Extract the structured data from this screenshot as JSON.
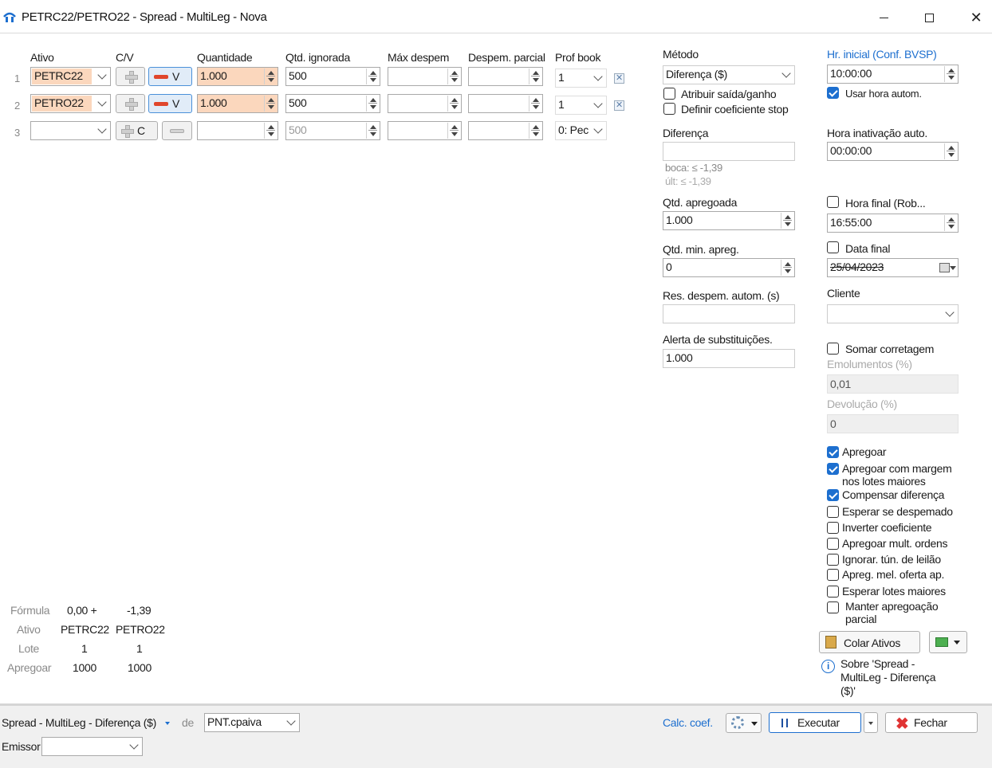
{
  "window": {
    "title": "PETRC22/PETRO22 - Spread - MultiLeg - Nova"
  },
  "grid": {
    "headers": {
      "ativo": "Ativo",
      "cv": "C/V",
      "quantidade": "Quantidade",
      "qtd_ignorada": "Qtd. ignorada",
      "max_despem": "Máx despem",
      "despem_parcial": "Despem. parcial",
      "prof_book": "Prof book"
    },
    "rows": [
      {
        "num": "1",
        "ativo": "PETRC22",
        "side_label": "V",
        "quantidade": "1.000",
        "qtd_ignorada": "500",
        "max_despem": "",
        "despem_parcial": "",
        "prof_book": "1"
      },
      {
        "num": "2",
        "ativo": "PETRO22",
        "side_label": "V",
        "quantidade": "1.000",
        "qtd_ignorada": "500",
        "max_despem": "",
        "despem_parcial": "",
        "prof_book": "1"
      },
      {
        "num": "3",
        "ativo": "",
        "side_label": "C",
        "quantidade": "",
        "qtd_ignorada": "500",
        "max_despem": "",
        "despem_parcial": "",
        "prof_book": "0: Pec"
      }
    ]
  },
  "formula": {
    "labels": {
      "formula": "Fórmula",
      "ativo": "Ativo",
      "lote": "Lote",
      "apregoar": "Apregoar"
    },
    "cols": [
      {
        "formula": "0,00 +",
        "ativo": "PETRC22",
        "lote": "1",
        "apregoar": "1000"
      },
      {
        "formula": "-1,39",
        "ativo": "PETRO22",
        "lote": "1",
        "apregoar": "1000"
      }
    ]
  },
  "mid": {
    "metodo_label": "Método",
    "metodo_value": "Diferença ($)",
    "atribuir_label": "Atribuir saída/ganho",
    "definir_label": "Definir coeficiente stop",
    "diferenca_label": "Diferença",
    "diferenca_value": "",
    "boca": "boca: ≤ -1,39",
    "ult": "últ: ≤ -1,39",
    "qtd_apregoada_label": "Qtd. apregoada",
    "qtd_apregoada_value": "1.000",
    "qtd_min_label": "Qtd. min. apreg.",
    "qtd_min_value": "0",
    "res_despem_label": "Res. despem. autom. (s)",
    "res_despem_value": "",
    "alerta_label": "Alerta de substituições.",
    "alerta_value": "1.000"
  },
  "right": {
    "hr_inicial_label": "Hr. inicial (Conf. BVSP)",
    "hr_inicial_value": "10:00:00",
    "usar_hora_label": "Usar hora autom.",
    "hora_inativ_label": "Hora inativação auto.",
    "hora_inativ_value": "00:00:00",
    "hora_final_label": "Hora final (Rob...",
    "hora_final_value": "16:55:00",
    "data_final_label": "Data final",
    "data_final_value": "25/04/2023",
    "cliente_label": "Cliente",
    "cliente_value": "",
    "somar_label": "Somar corretagem",
    "emolumentos_label": "Emolumentos (%)",
    "emolumentos_value": "0,01",
    "devolucao_label": "Devolução (%)",
    "devolucao_value": "0",
    "options": [
      {
        "label": "Apregoar",
        "checked": true
      },
      {
        "label": "Apregoar com margem",
        "label2": "nos lotes maiores",
        "checked": true
      },
      {
        "label": "Compensar diferença",
        "checked": true
      },
      {
        "label": "Esperar se despemado",
        "checked": false
      },
      {
        "label": "Inverter coeficiente",
        "checked": false
      },
      {
        "label": "Apregoar mult. ordens",
        "checked": false
      },
      {
        "label": "Ignorar. tún. de leilão",
        "checked": false
      },
      {
        "label": "Apreg. mel. oferta ap.",
        "checked": false
      },
      {
        "label": "Esperar lotes maiores",
        "checked": false
      },
      {
        "label": "Manter apregoação",
        "label2": "parcial",
        "checked": false
      }
    ],
    "colar_label": "Colar Ativos",
    "sobre_l1": "Sobre 'Spread -",
    "sobre_l2": "MultiLeg - Diferença",
    "sobre_l3": "($)'"
  },
  "bottom": {
    "strategy": "Spread - MultiLeg - Diferença ($)",
    "de": "de",
    "account": "PNT.cpaiva",
    "emissor_label": "Emissor",
    "emissor_value": "",
    "calc_coef": "Calc. coef.",
    "executar": "Executar",
    "fechar": "Fechar"
  },
  "colors": {
    "accent": "#1d6fcf",
    "qty_bg": "#fbd7bd",
    "sell": "#e0462c"
  }
}
